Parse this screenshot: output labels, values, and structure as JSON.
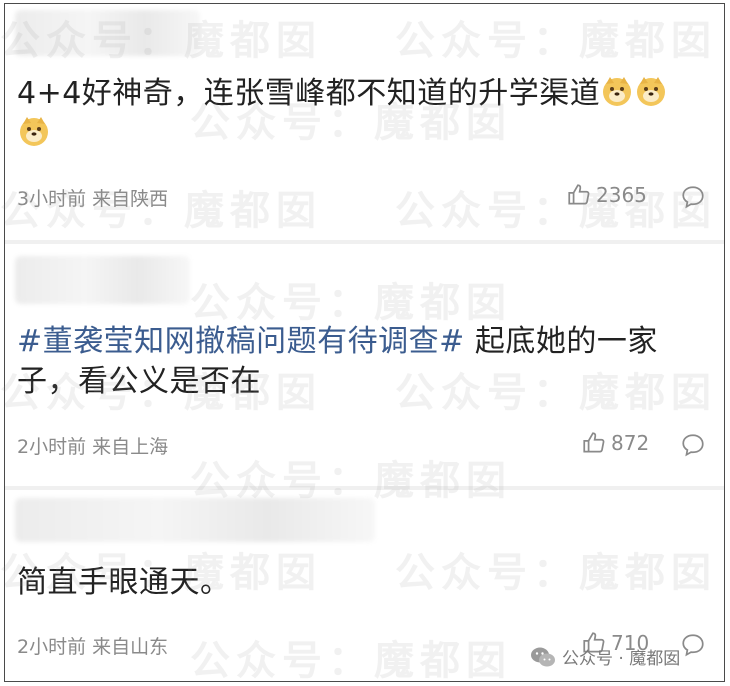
{
  "watermark": {
    "text": "公众号：魔都囡"
  },
  "comments": [
    {
      "text": "4+4好神奇，连张雪峰都不知道的升学渠道",
      "meta": "3小时前 来自陕西",
      "likes": "2365",
      "emoji": "doge-emoji"
    },
    {
      "hashtag": "#董袭莹知网撤稿问题有待调查#",
      "text": " 起底她的一家子，看公义是否在",
      "meta": "2小时前 来自上海",
      "likes": "872"
    },
    {
      "text": "简直手眼通天。",
      "meta": "2小时前 来自山东",
      "likes": "710"
    }
  ],
  "footer": {
    "account": "公众号 · 魔都囡",
    "icon": "wechat-icon"
  }
}
